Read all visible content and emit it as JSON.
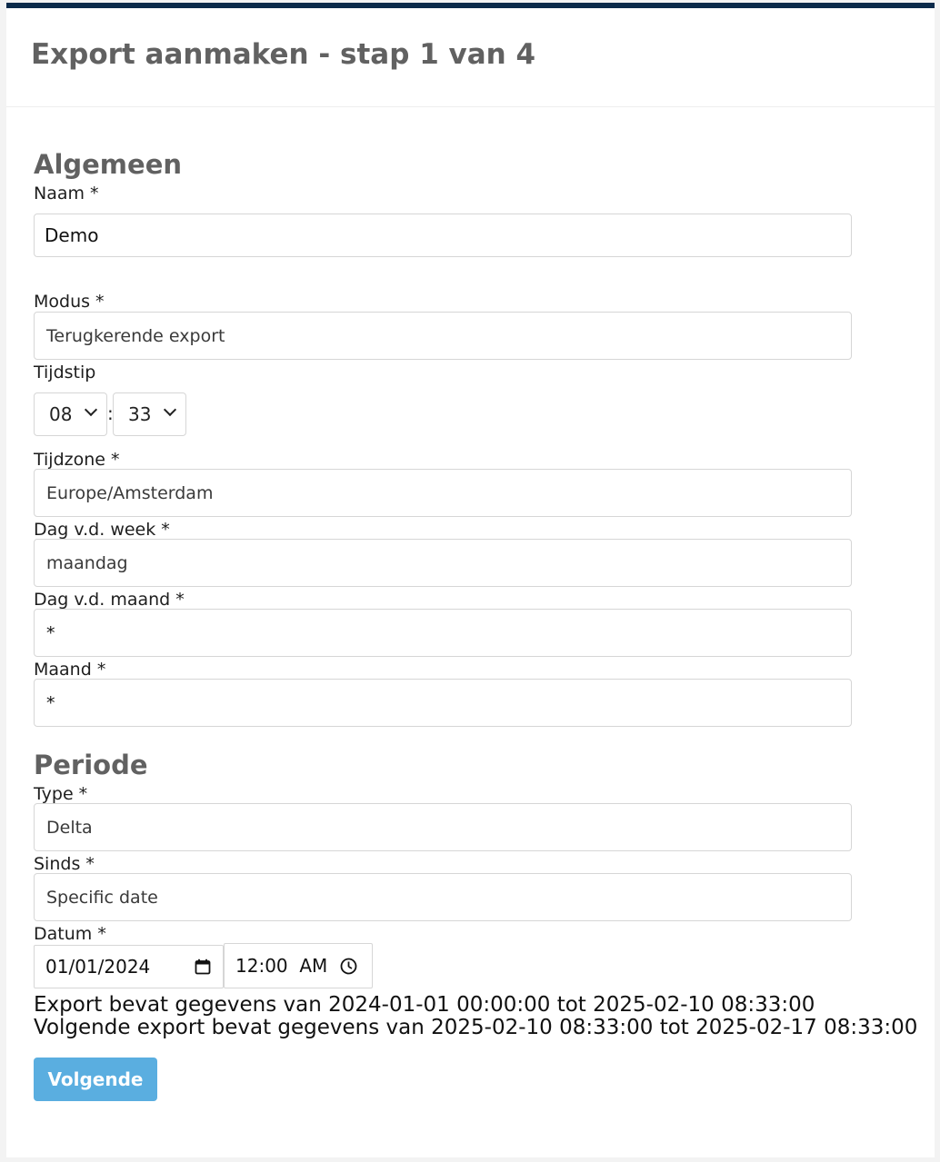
{
  "header": {
    "title": "Export aanmaken - stap 1 van 4"
  },
  "general": {
    "section_title": "Algemeen",
    "name_label": "Naam *",
    "name_value": "Demo",
    "mode_label": "Modus *",
    "mode_value": "Terugkerende export",
    "time_label": "Tijdstip",
    "hour_value": "08",
    "time_separator": ":",
    "minute_value": "33",
    "timezone_label": "Tijdzone *",
    "timezone_value": "Europe/Amsterdam",
    "weekday_label": "Dag v.d. week *",
    "weekday_value": "maandag",
    "monthday_label": "Dag v.d. maand *",
    "monthday_value": "*",
    "month_label": "Maand *",
    "month_value": "*"
  },
  "period": {
    "section_title": "Periode",
    "type_label": "Type *",
    "type_value": "Delta",
    "since_label": "Sinds *",
    "since_value": "Specific date",
    "date_label": "Datum *",
    "date_value": "01/01/2024",
    "time_value": "12:00  AM"
  },
  "info": {
    "line1": "Export bevat gegevens van 2024-01-01 00:00:00 tot 2025-02-10 08:33:00",
    "line2": "Volgende export bevat gegevens van 2025-02-10 08:33:00 tot 2025-02-17 08:33:00"
  },
  "actions": {
    "next_label": "Volgende"
  },
  "icons": {
    "select_chevron": "chevron-down-icon",
    "date_picker": "calendar-icon",
    "time_picker": "clock-icon"
  },
  "colors": {
    "top_bar": "#0b2a4a",
    "title_text": "#616161",
    "button_bg": "#5aaee0",
    "field_border": "#d6d6d6"
  }
}
